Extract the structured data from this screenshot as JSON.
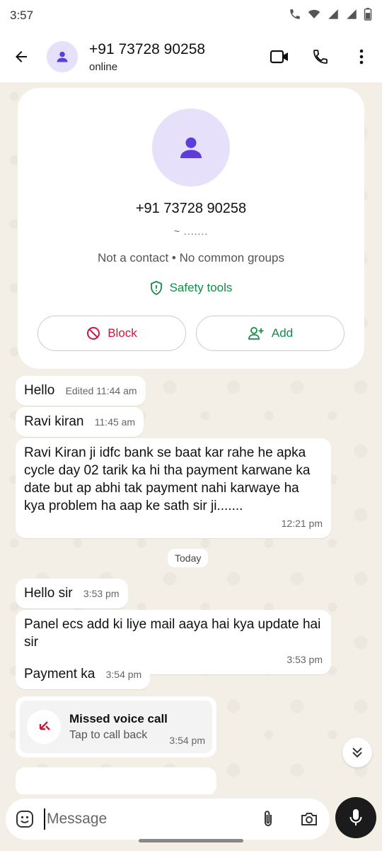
{
  "status_bar": {
    "time": "3:57"
  },
  "header": {
    "title": "+91 73728 90258",
    "status": "online"
  },
  "contact_card": {
    "phone": "+91 73728 90258",
    "name": "~ .......",
    "info": "Not a contact • No common groups",
    "safety_label": "Safety tools",
    "block_label": "Block",
    "add_label": "Add"
  },
  "messages": [
    {
      "text": "Hello",
      "meta": "Edited 11:44 am"
    },
    {
      "text": "Ravi kiran",
      "meta": "11:45 am"
    },
    {
      "text": "Ravi Kiran ji idfc bank se baat kar rahe he apka cycle day 02 tarik ka hi tha payment karwane ka date but ap abhi tak payment nahi karwaye ha kya problem ha aap ke sath sir ji.......",
      "meta": "12:21 pm"
    },
    {
      "text": "Hello sir",
      "meta": "3:53 pm"
    },
    {
      "text": "Panel ecs add ki liye mail aaya hai kya update hai sir",
      "meta": "3:53 pm"
    },
    {
      "text": "Payment ka",
      "meta": "3:54 pm"
    }
  ],
  "date_chip": "Today",
  "missed_call": {
    "title": "Missed voice call",
    "subtitle": "Tap to call back",
    "time": "3:54 pm"
  },
  "composer": {
    "placeholder": "Message"
  },
  "colors": {
    "accent_green": "#178a4a",
    "block_red": "#d0173e",
    "avatar_bg": "#e6e0fb",
    "avatar_icon": "#5b3fd8",
    "chat_bg": "#f4efe6"
  }
}
